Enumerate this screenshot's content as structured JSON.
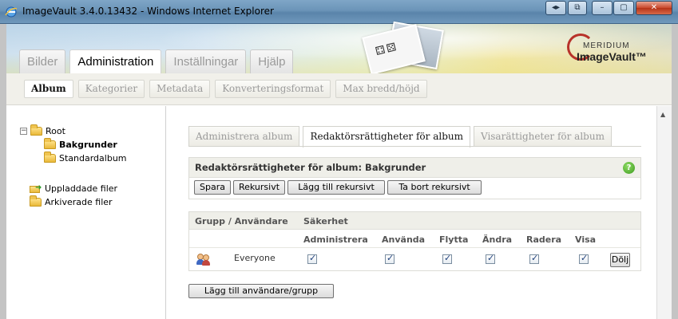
{
  "window": {
    "title": "ImageVault 3.4.0.13432 - Windows Internet Explorer",
    "minimize": "–",
    "maximize": "▢",
    "close": "✕"
  },
  "brand": {
    "company": "MERIDIUM",
    "product": "ImageVault™"
  },
  "main_tabs": [
    {
      "label": "Bilder",
      "active": false
    },
    {
      "label": "Administration",
      "active": true
    },
    {
      "label": "Inställningar",
      "active": false
    },
    {
      "label": "Hjälp",
      "active": false
    }
  ],
  "sub_tabs": [
    {
      "label": "Album",
      "active": true
    },
    {
      "label": "Kategorier",
      "active": false
    },
    {
      "label": "Metadata",
      "active": false
    },
    {
      "label": "Konverteringsformat",
      "active": false
    },
    {
      "label": "Max bredd/höjd",
      "active": false
    }
  ],
  "tree": {
    "expander": "−",
    "root": "Root",
    "children": [
      "Bakgrunder",
      "Standardalbum"
    ],
    "selected": "Bakgrunder",
    "uploaded": "Uppladdade filer",
    "archived": "Arkiverade filer"
  },
  "content_tabs": [
    {
      "label": "Administrera album",
      "active": false
    },
    {
      "label": "Redaktörsrättigheter för album",
      "active": true
    },
    {
      "label": "Visarättigheter för album",
      "active": false
    }
  ],
  "panel": {
    "heading": "Redaktörsrättigheter för album: Bakgrunder",
    "help": "?",
    "buttons": [
      "Spara",
      "Rekursivt",
      "Lägg till rekursivt",
      "Ta bort rekursivt"
    ]
  },
  "permissions": {
    "col_group": "Grupp / Användare",
    "col_security": "Säkerhet",
    "columns": [
      "Administrera",
      "Använda",
      "Flytta",
      "Ändra",
      "Radera",
      "Visa"
    ],
    "rows": [
      {
        "name": "Everyone",
        "checked": [
          true,
          true,
          true,
          true,
          true,
          true
        ],
        "action": "Dölj"
      }
    ]
  },
  "add_button": "Lägg till användare/grupp"
}
